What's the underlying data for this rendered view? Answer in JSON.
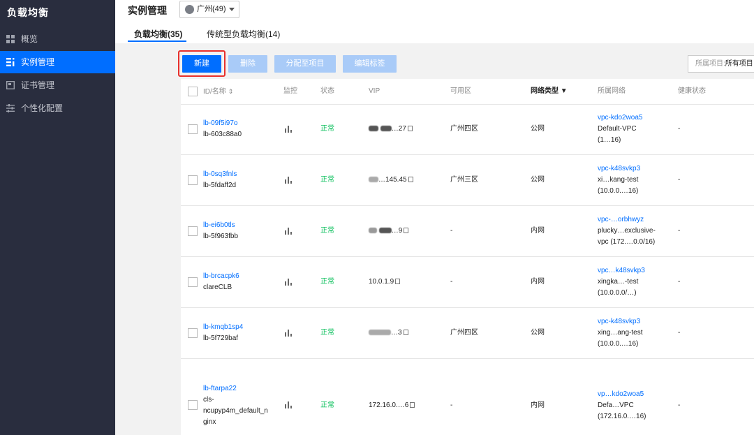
{
  "sidebar": {
    "title": "负载均衡",
    "items": [
      {
        "label": "概览",
        "icon": "grid-icon",
        "active": false
      },
      {
        "label": "实例管理",
        "icon": "list-icon",
        "active": true
      },
      {
        "label": "证书管理",
        "icon": "certificate-icon",
        "active": false
      },
      {
        "label": "个性化配置",
        "icon": "sliders-icon",
        "active": false
      }
    ]
  },
  "header": {
    "title": "实例管理",
    "region": "广州(49)"
  },
  "tabs": [
    {
      "label": "负载均衡(35)",
      "active": true
    },
    {
      "label": "传统型负载均衡(14)",
      "active": false
    }
  ],
  "toolbar": {
    "new_label": "新建",
    "delete_label": "删除",
    "assign_label": "分配至项目",
    "edit_tags_label": "编辑标签",
    "project_label": "所属项目:",
    "project_value": "所有项目"
  },
  "table": {
    "columns": [
      "ID/名称",
      "监控",
      "状态",
      "VIP",
      "可用区",
      "网络类型",
      "所属网络",
      "健康状态"
    ],
    "rows": [
      {
        "id": "lb-09f5i97o",
        "name": "lb-603c88a0",
        "status": "正常",
        "vip": "…27",
        "zone": "广州四区",
        "net_type": "公网",
        "vpc_id": "vpc-kdo2woa5",
        "vpc_name": "Default-VPC",
        "vpc_cidr": "(1…16)",
        "health": "-"
      },
      {
        "id": "lb-0sq3fnls",
        "name": "lb-5fdaff2d",
        "status": "正常",
        "vip": "…145.45",
        "zone": "广州三区",
        "net_type": "公网",
        "vpc_id": "vpc-k48svkp3",
        "vpc_name": "xi…kang-test",
        "vpc_cidr": "(10.0.0.…16)",
        "health": "-"
      },
      {
        "id": "lb-ei6b0tls",
        "name": "lb-5f963fbb",
        "status": "正常",
        "vip": "…9",
        "zone": "-",
        "net_type": "内网",
        "vpc_id": "vpc-…orbhwyz",
        "vpc_name": "plucky…exclusive-",
        "vpc_cidr": "vpc (172.…0.0/16)",
        "health": "-"
      },
      {
        "id": "lb-brcacpk6",
        "name": "clareCLB",
        "status": "正常",
        "vip": "10.0.1.9",
        "zone": "-",
        "net_type": "内网",
        "vpc_id": "vpc…k48svkp3",
        "vpc_name": "xingka…-test",
        "vpc_cidr": "(10.0.0.0/…)",
        "health": "-"
      },
      {
        "id": "lb-kmqb1sp4",
        "name": "lb-5f729baf",
        "status": "正常",
        "vip": "…3",
        "zone": "广州四区",
        "net_type": "公网",
        "vpc_id": "vpc-k48svkp3",
        "vpc_name": "xing…ang-test",
        "vpc_cidr": "(10.0.0.…16)",
        "health": "-"
      },
      {
        "id": "lb-ftarpa22",
        "name": "cls-",
        "name2": "ncupyp4m_default_n",
        "name3": "ginx",
        "status": "正常",
        "vip": "172.16.0.…6",
        "zone": "-",
        "net_type": "内网",
        "vpc_id": "vp…kdo2woa5",
        "vpc_name": "Defa…VPC",
        "vpc_cidr": "(172.16.0.…16)",
        "health": "-"
      }
    ]
  },
  "colors": {
    "sidebar_bg": "#292d3e",
    "accent": "#006eff",
    "ok": "#0abf5b",
    "highlight": "#e8302c"
  }
}
